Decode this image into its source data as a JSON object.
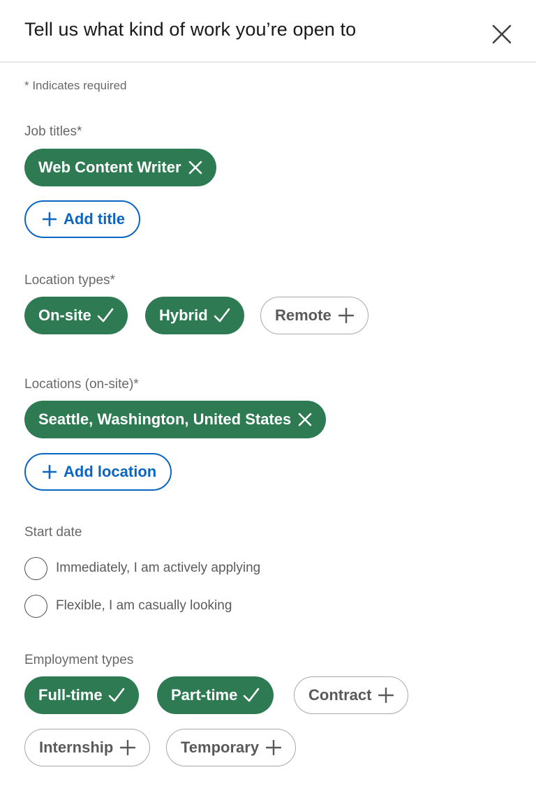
{
  "modal": {
    "title": "Tell us what kind of work you’re open to",
    "close_icon": "close-icon"
  },
  "required_note": "* Indicates required",
  "job_titles": {
    "label": "Job titles*",
    "selected": [
      "Web Content Writer"
    ],
    "add_label": "Add title"
  },
  "location_types": {
    "label": "Location types*",
    "options": [
      {
        "label": "On-site",
        "selected": true
      },
      {
        "label": "Hybrid",
        "selected": true
      },
      {
        "label": "Remote",
        "selected": false
      }
    ]
  },
  "locations": {
    "label": "Locations (on-site)*",
    "selected": [
      "Seattle, Washington, United States"
    ],
    "add_label": "Add location"
  },
  "start_date": {
    "label": "Start date",
    "options": [
      {
        "label": "Immediately, I am actively applying",
        "checked": false
      },
      {
        "label": "Flexible, I am casually looking",
        "checked": false
      }
    ]
  },
  "employment_types": {
    "label": "Employment types",
    "options": [
      {
        "label": "Full-time",
        "selected": true
      },
      {
        "label": "Part-time",
        "selected": true
      },
      {
        "label": "Contract",
        "selected": false
      },
      {
        "label": "Internship",
        "selected": false
      },
      {
        "label": "Temporary",
        "selected": false
      }
    ]
  },
  "colors": {
    "selected_pill": "#2e7b53",
    "link_blue": "#0a66c2"
  }
}
